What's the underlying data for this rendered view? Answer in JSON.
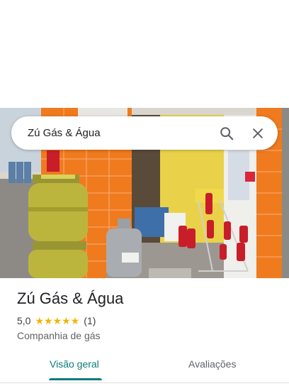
{
  "search": {
    "query": "Zú Gás & Água"
  },
  "place": {
    "name": "Zú Gás & Água",
    "rating": "5,0",
    "stars": 5,
    "review_count": "(1)",
    "category": "Companhia de gás"
  },
  "tabs": [
    {
      "label": "Visão geral",
      "selected": true
    },
    {
      "label": "Avaliações",
      "selected": false
    }
  ],
  "colors": {
    "accent": "#0b7a7a",
    "star": "#f4b400"
  },
  "icons": {
    "search": "search-icon",
    "close": "close-icon"
  }
}
